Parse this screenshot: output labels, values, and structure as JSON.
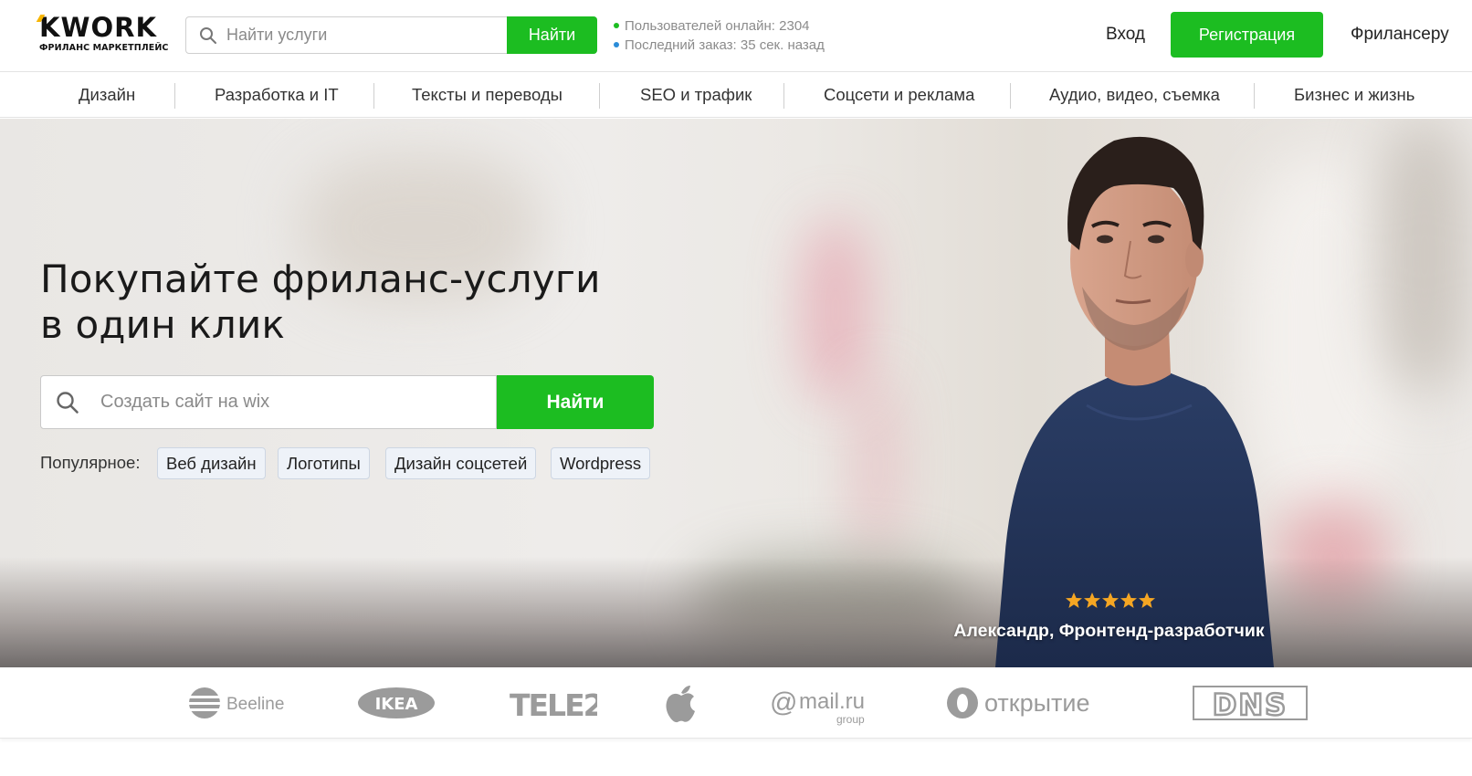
{
  "header": {
    "logo_text": "KWORK",
    "logo_subtitle": "ФРИЛАНС МАРКЕТПЛЕЙС",
    "search_placeholder": "Найти услуги",
    "search_button": "Найти",
    "online_users": "Пользователей онлайн: 2304",
    "last_order": "Последний заказ: 35 сек. назад",
    "online_dot_color": "#1cbd21",
    "order_dot_color": "#2a8cd8",
    "login_label": "Вход",
    "register_label": "Регистрация",
    "freelancer_label": "Фрилансеру"
  },
  "categories": [
    "Дизайн",
    "Разработка и IT",
    "Тексты и переводы",
    "SEO и трафик",
    "Соцсети и реклама",
    "Аудио, видео, съемка",
    "Бизнес и жизнь"
  ],
  "hero": {
    "title_line1": "Покупайте фриланс-услуги",
    "title_line2": "в один клик",
    "search_placeholder": "Создать сайт на wix",
    "search_button": "Найти",
    "popular_label": "Популярное:",
    "popular_tags": [
      "Веб дизайн",
      "Логотипы",
      "Дизайн соцсетей",
      "Wordpress"
    ],
    "rating_stars": 5,
    "star_color": "#f5a623",
    "person_caption": "Александр, Фронтенд-разработчик"
  },
  "partners": {
    "beeline": "Beeline",
    "ikea": "IKEA",
    "tele2": "TELE2",
    "apple": "apple-icon",
    "mailru": "mail.ru",
    "mailru_sub": "group",
    "otkritie": "открытие",
    "dns": "DNS"
  },
  "colors": {
    "accent_green": "#1cbd21",
    "logo_yellow": "#f7b500"
  }
}
